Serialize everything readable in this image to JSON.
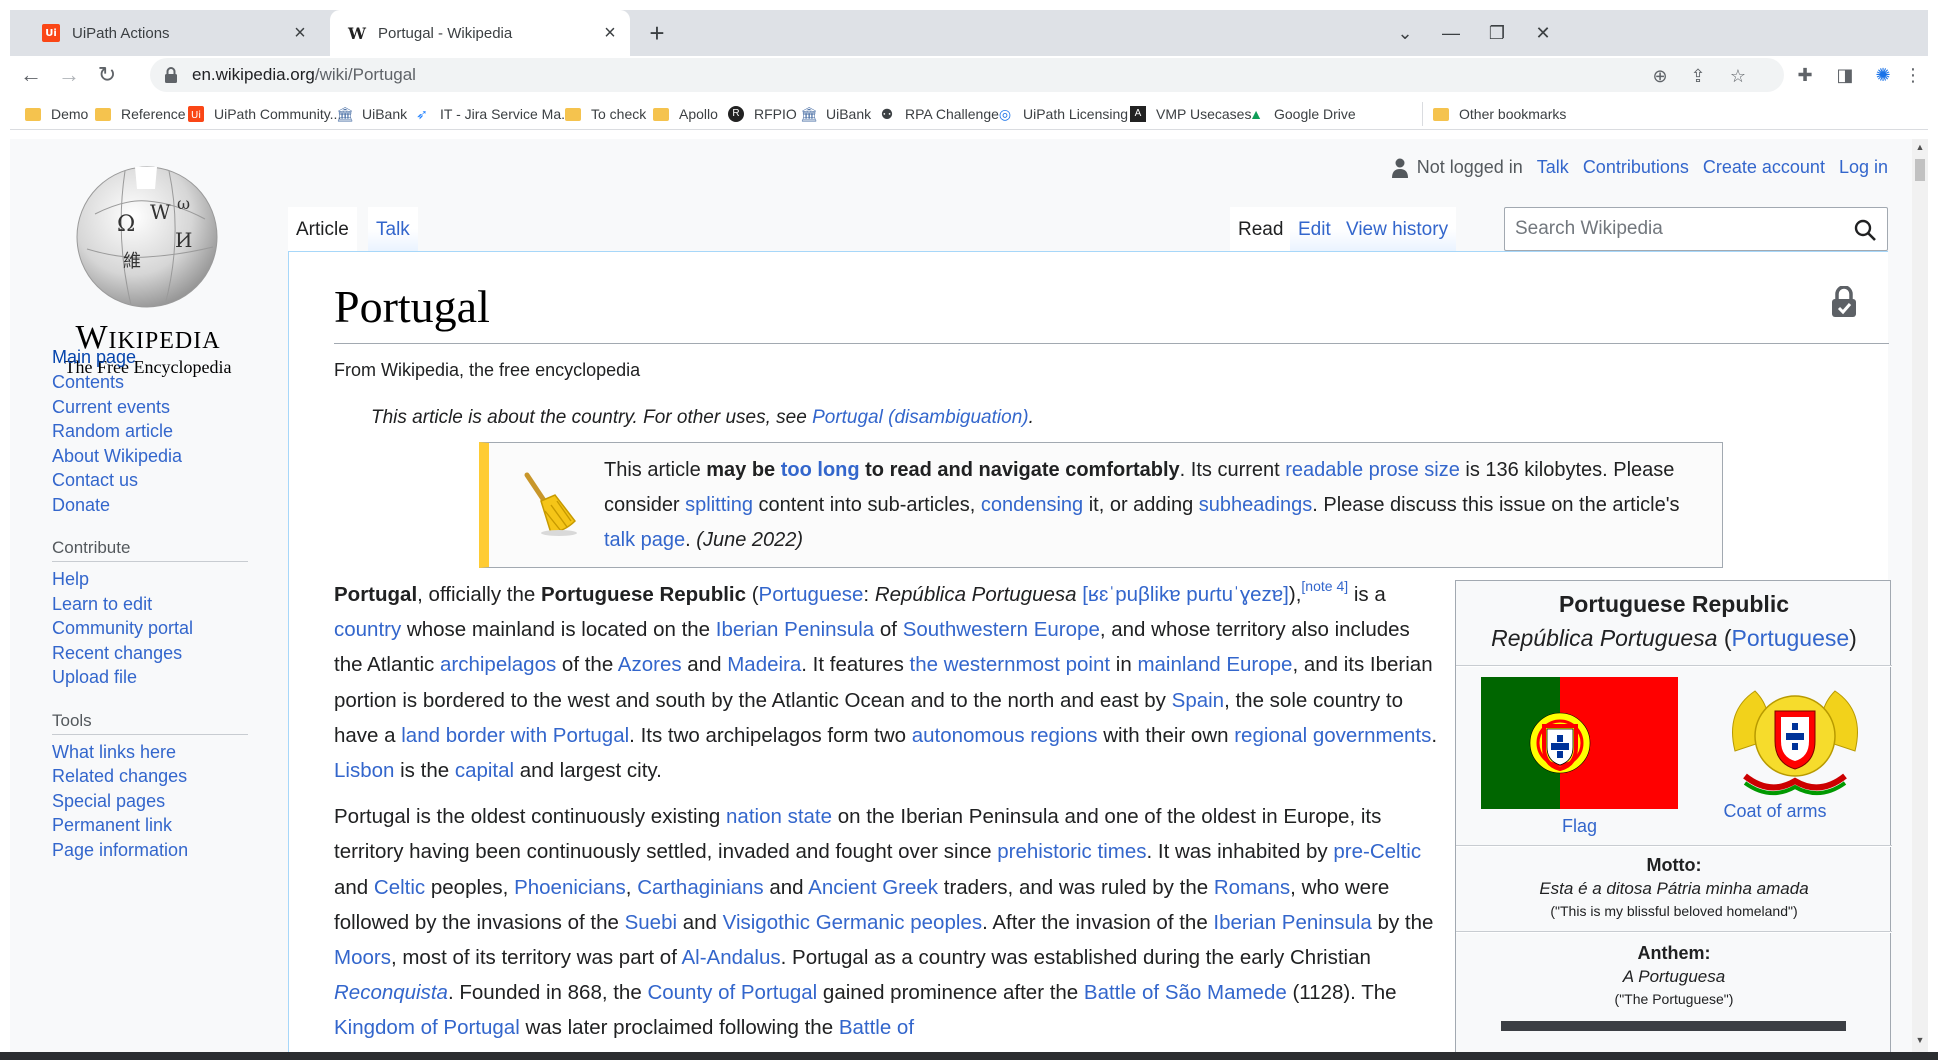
{
  "browser": {
    "tabs": [
      {
        "title": "UiPath Actions",
        "favicon": "uipath-logo-icon",
        "active": false
      },
      {
        "title": "Portugal - Wikipedia",
        "favicon": "wikipedia-w-icon",
        "active": true
      }
    ],
    "new_tab": "+",
    "url": {
      "domain": "en.wikipedia.org",
      "path": "/wiki/Portugal"
    },
    "bookmarks": [
      {
        "label": "Demo",
        "icon": "folder-icon"
      },
      {
        "label": "Reference",
        "icon": "folder-icon"
      },
      {
        "label": "UiPath Community...",
        "icon": "uipath-logo-icon"
      },
      {
        "label": "UiBank",
        "icon": "bank-icon"
      },
      {
        "label": "IT - Jira Service Ma...",
        "icon": "jira-icon"
      },
      {
        "label": "To check",
        "icon": "folder-icon"
      },
      {
        "label": "Apollo",
        "icon": "folder-icon"
      },
      {
        "label": "RFPIO",
        "icon": "rfpio-icon"
      },
      {
        "label": "UiBank",
        "icon": "bank-icon"
      },
      {
        "label": "RPA Challenge",
        "icon": "robot-icon"
      },
      {
        "label": "UiPath Licensing",
        "icon": "uipath-circle-icon"
      },
      {
        "label": "VMP Usecases",
        "icon": "angular-icon"
      },
      {
        "label": "Google Drive",
        "icon": "google-drive-icon"
      }
    ],
    "other_bookmarks": "Other bookmarks"
  },
  "wiki": {
    "logo": {
      "wordmark": "Wikipedia",
      "tagline": "The Free Encyclopedia"
    },
    "personal": {
      "not_logged_in": "Not logged in",
      "links": [
        "Talk",
        "Contributions",
        "Create account",
        "Log in"
      ]
    },
    "tabs_left": [
      "Article",
      "Talk"
    ],
    "tabs_right": [
      "Read",
      "Edit",
      "View history"
    ],
    "search_placeholder": "Search Wikipedia",
    "navigation": [
      "Main page",
      "Contents",
      "Current events",
      "Random article",
      "About Wikipedia",
      "Contact us",
      "Donate"
    ],
    "contribute": {
      "heading": "Contribute",
      "items": [
        "Help",
        "Learn to edit",
        "Community portal",
        "Recent changes",
        "Upload file"
      ]
    },
    "tools": {
      "heading": "Tools",
      "items": [
        "What links here",
        "Related changes",
        "Special pages",
        "Permanent link",
        "Page information"
      ]
    },
    "title": "Portugal",
    "site_sub": "From Wikipedia, the free encyclopedia",
    "hatnote": {
      "text": "This article is about the country. For other uses, see ",
      "link": "Portugal (disambiguation)",
      "end": "."
    },
    "ambox": {
      "t1": "This article ",
      "b1": "may be ",
      "l1": "too long",
      "b2": " to read and navigate comfortably",
      "t2": ". Its current ",
      "l2": "readable prose size",
      "t3": " is 136 kilobytes. Please consider ",
      "l3": "splitting",
      "t4": " content into sub-articles, ",
      "l4": "condensing",
      "t5": " it, or adding ",
      "l5": "subheadings",
      "t6": ". Please discuss this issue on the article's ",
      "l6": "talk page",
      "t7": ". ",
      "date": "(June 2022)"
    },
    "lead_p1": {
      "b1": "Portugal",
      "t1": ", officially the ",
      "b2": "Portuguese Republic",
      "t2": " (",
      "l1": "Portuguese",
      "t3": ": ",
      "i1": "República Portuguesa",
      "t4": " ",
      "ipa": "[ʁɛˈpuβlikɐ puɾtuˈɣezɐ]",
      "t5": "),",
      "note": "[note 4]",
      "t6": " is a ",
      "l2": "country",
      "t7": " whose mainland is located on the ",
      "l3": "Iberian Peninsula",
      "t8": " of ",
      "l4": "Southwestern Europe",
      "t9": ", and whose territory also includes the Atlantic ",
      "l5": "archipelagos",
      "t10": " of the ",
      "l6": "Azores",
      "t11": " and ",
      "l7": "Madeira",
      "t12": ". It features ",
      "l8": "the westernmost point",
      "t13": " in ",
      "l9": "mainland Europe",
      "t14": ", and its Iberian portion is bordered to the west and south by the Atlantic Ocean and to the north and east by ",
      "l10": "Spain",
      "t15": ", the sole country to have a ",
      "l11": "land border with Portugal",
      "t16": ". Its two archipelagos form two ",
      "l12": "autonomous regions",
      "t17": " with their own ",
      "l13": "regional governments",
      "t18": ". ",
      "l14": "Lisbon",
      "t19": " is the ",
      "l15": "capital",
      "t20": " and largest city."
    },
    "lead_p2": {
      "t1": "Portugal is the oldest continuously existing ",
      "l1": "nation state",
      "t2": " on the Iberian Peninsula and one of the oldest in Europe, its territory having been continuously settled, invaded and fought over since ",
      "l2": "prehistoric times",
      "t3": ". It was inhabited by ",
      "l3": "pre-Celtic",
      "t4": " and ",
      "l4": "Celtic",
      "t5": " peoples, ",
      "l5": "Phoenicians",
      "t6": ", ",
      "l6": "Carthaginians",
      "t7": " and ",
      "l7": "Ancient Greek",
      "t8": " traders, and was ruled by the ",
      "l8": "Romans",
      "t9": ", who were followed by the invasions of the ",
      "l9": "Suebi",
      "t10": " and ",
      "l10": "Visigothic Germanic peoples",
      "t11": ". After the invasion of the ",
      "l11": "Iberian Peninsula",
      "t12": " by the ",
      "l12": "Moors",
      "t13": ", most of its territory was part of ",
      "l13": "Al-Andalus",
      "t14": ". Portugal as a country was established during the early Christian ",
      "l14": "Reconquista",
      "t15": ". Founded in 868, the ",
      "l15": "County of Portugal",
      "t16": " gained prominence after the ",
      "l16": "Battle of São Mamede",
      "t17": " (1128). The ",
      "l17": "Kingdom of Portugal",
      "t18": " was later proclaimed following the ",
      "l18": "Battle of"
    },
    "infobox": {
      "title": "Portuguese Republic",
      "native_name": "República Portuguesa",
      "native_lang_open": " (",
      "native_lang": "Portuguese",
      "native_lang_close": ")",
      "flag_caption": "Flag",
      "coat_caption": "Coat of arms",
      "motto_label": "Motto:",
      "motto": "Esta é a ditosa Pátria minha amada",
      "motto_translation": "(\"This is my blissful beloved homeland\")",
      "anthem_label": "Anthem:",
      "anthem": "A Portuguesa",
      "anthem_translation": "(\"The Portuguese\")"
    }
  },
  "colors": {
    "link": "#3366cc",
    "ambox_accent": "#ffcc33",
    "flag_green": "#006600",
    "flag_red": "#ff0000"
  }
}
